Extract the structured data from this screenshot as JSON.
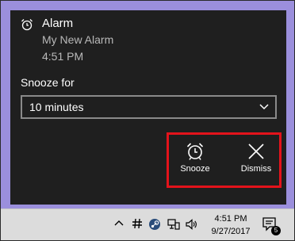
{
  "toast": {
    "app_name": "Alarm",
    "alarm_name": "My New Alarm",
    "alarm_time": "4:51 PM",
    "snooze_label": "Snooze for",
    "snooze_select": {
      "value": "10 minutes"
    },
    "actions": {
      "snooze": "Snooze",
      "dismiss": "Dismiss"
    }
  },
  "taskbar": {
    "time": "4:51 PM",
    "date": "9/27/2017",
    "notification_count": "5"
  },
  "colors": {
    "desktop": "#9b8fdc",
    "toast_background": "#1f1f1f",
    "highlight": "#e3131b",
    "taskbar": "#dcdcdc"
  }
}
